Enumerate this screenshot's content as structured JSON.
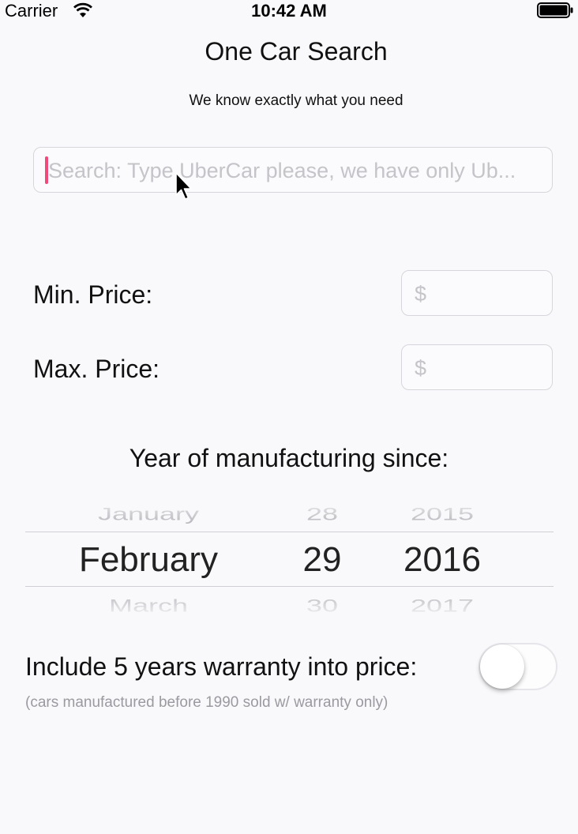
{
  "status_bar": {
    "carrier": "Carrier",
    "time": "10:42 AM",
    "wifi_icon": "wifi-icon",
    "battery_icon": "battery-icon"
  },
  "header": {
    "title": "One Car Search",
    "subtitle": "We know exactly what you need"
  },
  "search": {
    "placeholder": "Search: Type UberCar please, we have only Ub...",
    "value": ""
  },
  "price": {
    "min_label": "Min. Price:",
    "min_placeholder": "$",
    "max_label": "Max. Price:",
    "max_placeholder": "$"
  },
  "year": {
    "heading": "Year of manufacturing since:",
    "month_prev": "January",
    "month_selected": "February",
    "month_next": "March",
    "day_prev": "28",
    "day_selected": "29",
    "day_next": "30",
    "year_prev": "2015",
    "year_selected": "2016",
    "year_next": "2017"
  },
  "warranty": {
    "label": "Include 5 years warranty into price:",
    "note": "(cars manufactured before 1990 sold w/ warranty only)",
    "enabled": false
  },
  "colors": {
    "caret": "#f0497a",
    "background": "#f9f9fb",
    "placeholder": "#c4c4c9"
  }
}
